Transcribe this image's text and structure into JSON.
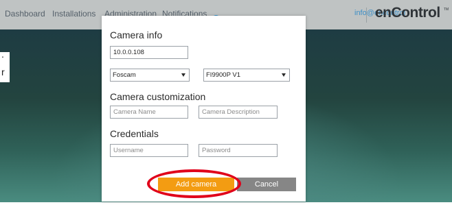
{
  "topbar": {
    "nav_items": [
      "Dashboard",
      "Installations",
      "Administration",
      "Notifications"
    ],
    "user_label": "info@encontrol",
    "logo": "enControl",
    "logo_tm": "TM"
  },
  "hero": {
    "line1": ".",
    "line2": "r"
  },
  "dialog": {
    "camera_info": {
      "title": "Camera info",
      "ip_value": "10.0.0.108",
      "brand": "Foscam",
      "model": "FI9900P V1"
    },
    "customization": {
      "title": "Camera customization",
      "name_placeholder": "Camera Name",
      "description_placeholder": "Camera Description"
    },
    "credentials": {
      "title": "Credentials",
      "username_placeholder": "Username",
      "password_placeholder": "Password"
    },
    "buttons": {
      "add": "Add camera",
      "cancel": "Cancel"
    }
  },
  "colors": {
    "accent": "#f39c12",
    "cancel": "#868686",
    "annotation": "#e0001a",
    "nav_text": "#55606a",
    "badge": "#2e8fc8"
  }
}
